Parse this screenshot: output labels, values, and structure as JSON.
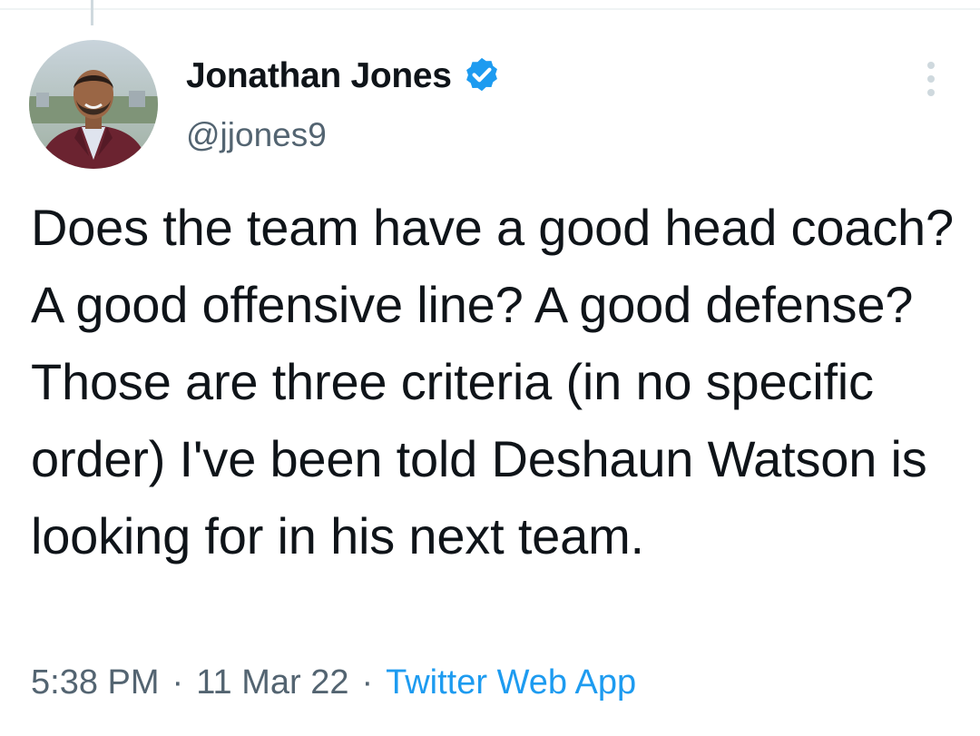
{
  "author": {
    "display_name": "Jonathan Jones",
    "handle": "@jjones9",
    "verified": true
  },
  "tweet": {
    "text": "Does the team have a good head coach? A good offensive line? A good defense? Those are three criteria (in no specific order) I've been told Deshaun Watson is looking for in his next team.",
    "time": "5:38 PM",
    "date": "11 Mar 22",
    "separator": "·",
    "source": "Twitter Web App"
  },
  "icons": {
    "verified": "verified-badge-icon",
    "more": "more-options-icon"
  },
  "colors": {
    "accent": "#1d9bf0",
    "secondary_text": "#536471",
    "primary_text": "#0f1419"
  }
}
